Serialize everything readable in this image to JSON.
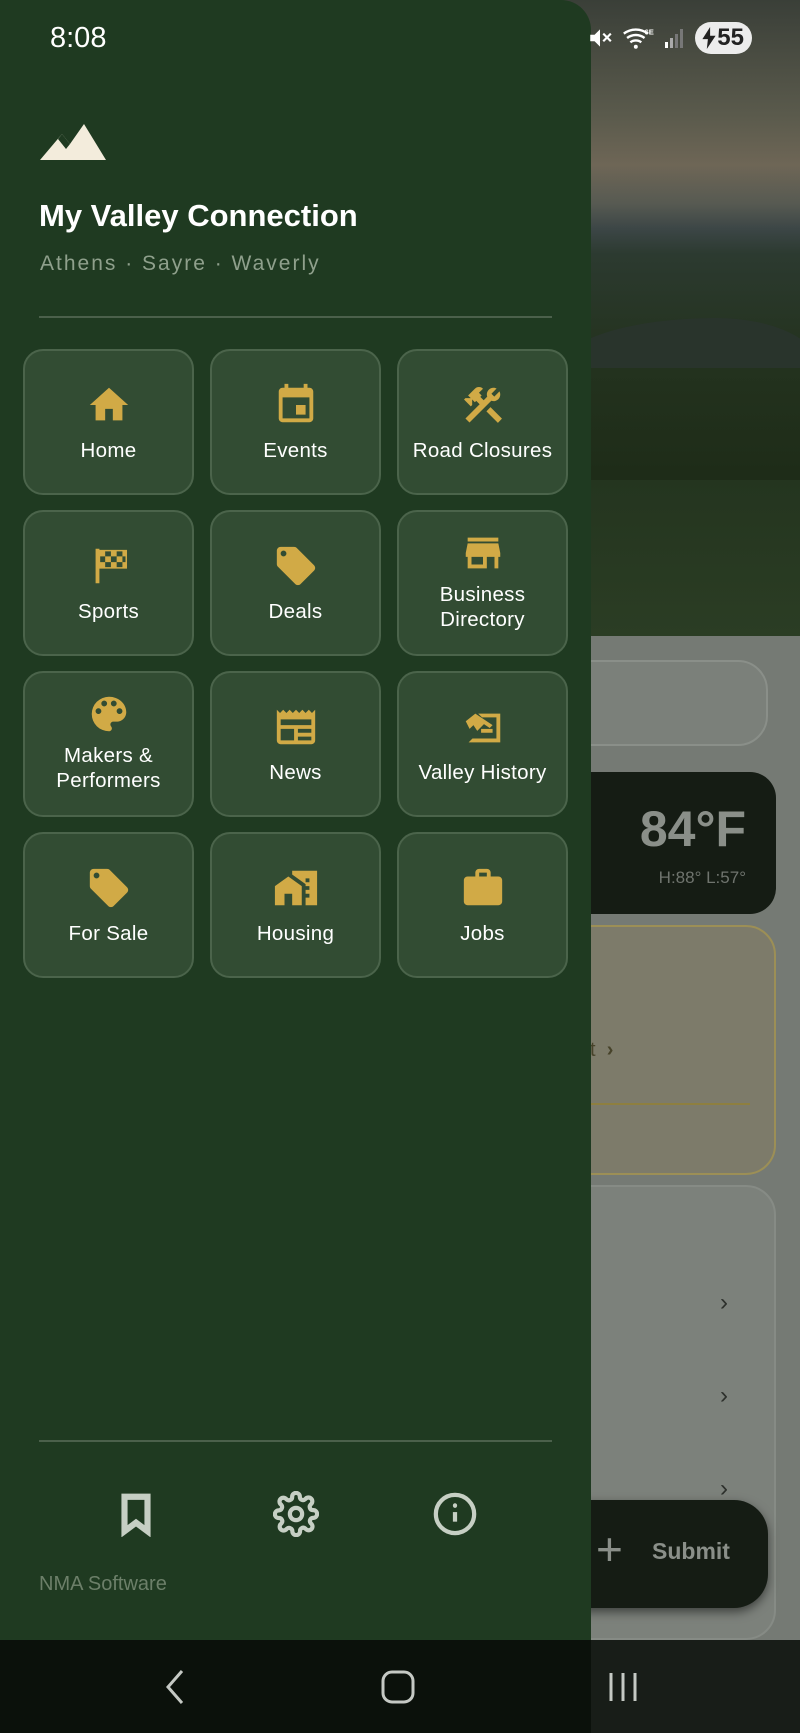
{
  "status_bar": {
    "time": "8:08",
    "battery": "55",
    "network": "6E"
  },
  "drawer": {
    "title": "My Valley Connection",
    "subtitle": "Athens · Sayre · Waverly",
    "items": [
      {
        "label": "Home",
        "icon": "home-icon"
      },
      {
        "label": "Events",
        "icon": "calendar-icon"
      },
      {
        "label": "Road Closures",
        "icon": "tools-icon"
      },
      {
        "label": "Sports",
        "icon": "checkered-flag-icon"
      },
      {
        "label": "Deals",
        "icon": "tag-icon"
      },
      {
        "label": "Business Directory",
        "icon": "storefront-icon"
      },
      {
        "label": "Makers & Performers",
        "icon": "palette-icon"
      },
      {
        "label": "News",
        "icon": "newspaper-icon"
      },
      {
        "label": "Valley History",
        "icon": "history-icon"
      },
      {
        "label": "For Sale",
        "icon": "tag-icon"
      },
      {
        "label": "Housing",
        "icon": "buildings-icon"
      },
      {
        "label": "Jobs",
        "icon": "briefcase-icon"
      }
    ],
    "footer_icons": [
      "bookmark-icon",
      "gear-icon",
      "info-icon"
    ],
    "credit": "NMA Software"
  },
  "background": {
    "temperature": "84°F",
    "hi_lo": "H:88°  L:57°",
    "alert_fragment": "t",
    "submit_label": "Submit"
  },
  "colors": {
    "drawer_bg": "#1f3a21",
    "tile_bg": "#324c33",
    "accent": "#d1aa46"
  }
}
